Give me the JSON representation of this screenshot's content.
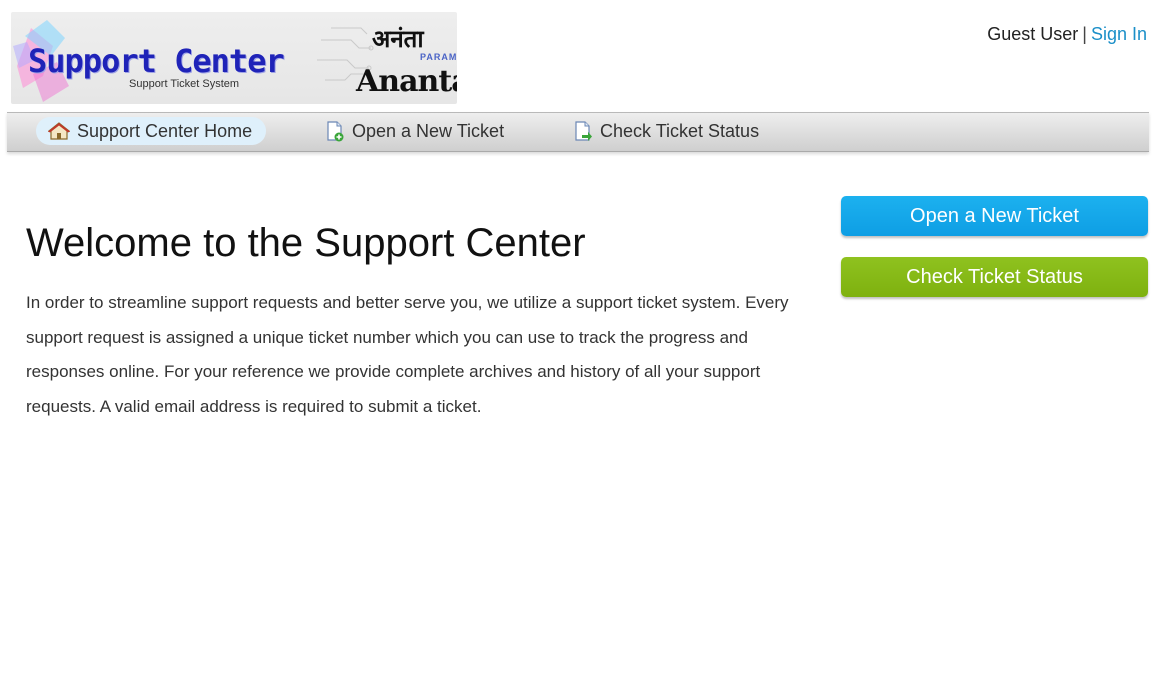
{
  "header": {
    "logo": {
      "title": "Support Center",
      "subtitle": "Support Ticket System",
      "brand_devanagari": "अनंता",
      "brand_param": "PARAM",
      "brand_name": "Ananta"
    },
    "user": {
      "guest_label": "Guest User",
      "separator": "|",
      "sign_in": "Sign In"
    }
  },
  "nav": {
    "items": [
      {
        "label": "Support Center Home",
        "icon": "home-icon",
        "active": true
      },
      {
        "label": "Open a New Ticket",
        "icon": "new-ticket-icon",
        "active": false
      },
      {
        "label": "Check Ticket Status",
        "icon": "ticket-status-icon",
        "active": false
      }
    ]
  },
  "main": {
    "title": "Welcome to the Support Center",
    "intro": "In order to streamline support requests and better serve you, we utilize a support ticket system. Every support request is assigned a unique ticket number which you can use to track the progress and responses online. For your reference we provide complete archives and history of all your support requests. A valid email address is required to submit a ticket."
  },
  "sidebar": {
    "open_ticket_button": "Open a New Ticket",
    "check_status_button": "Check Ticket Status"
  },
  "colors": {
    "link": "#1b8fc8",
    "open_button": "#13a8ea",
    "status_button": "#86b917",
    "logo_title": "#1f23b8"
  }
}
